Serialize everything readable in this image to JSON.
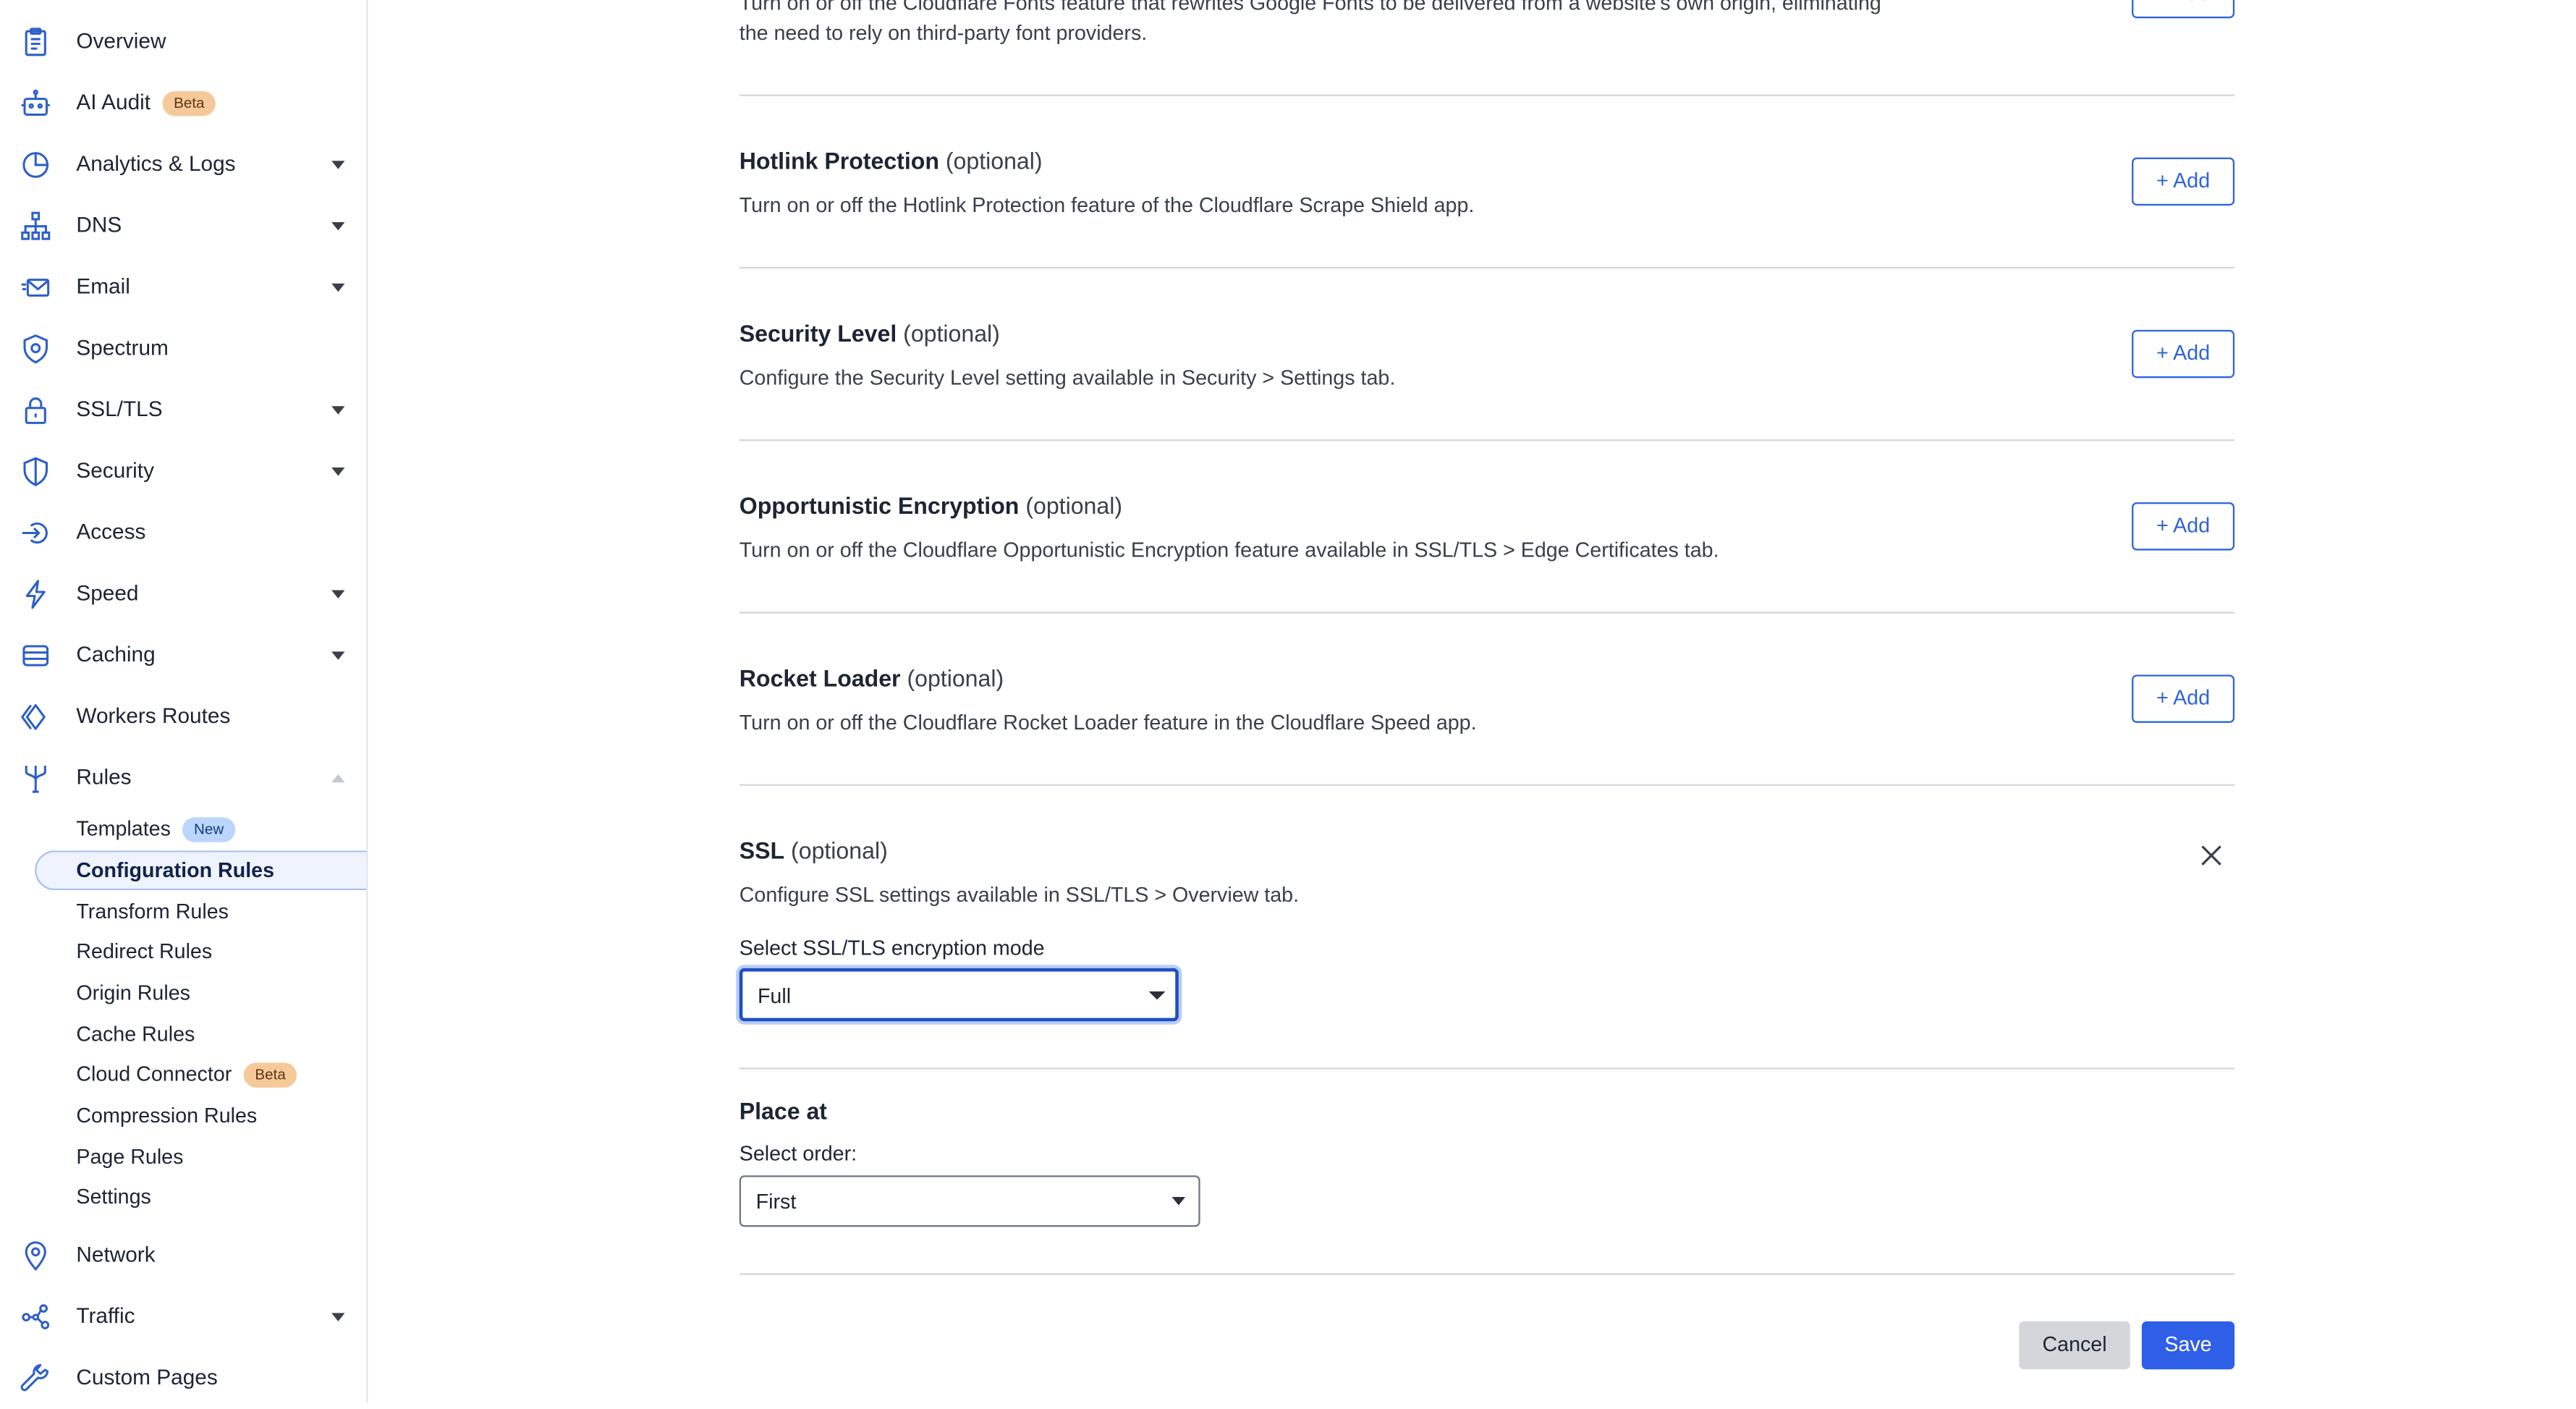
{
  "sidebar": {
    "items": [
      {
        "label": "Overview",
        "icon": "clipboard-icon"
      },
      {
        "label": "AI Audit",
        "icon": "robot-icon",
        "badge": "Beta"
      },
      {
        "label": "Analytics & Logs",
        "icon": "pie-chart-icon"
      },
      {
        "label": "DNS",
        "icon": "network-tree-icon"
      },
      {
        "label": "Email",
        "icon": "email-icon"
      },
      {
        "label": "Spectrum",
        "icon": "shield-gear-icon"
      },
      {
        "label": "SSL/TLS",
        "icon": "lock-icon"
      },
      {
        "label": "Security",
        "icon": "shield-icon"
      },
      {
        "label": "Access",
        "icon": "access-icon"
      },
      {
        "label": "Speed",
        "icon": "lightning-icon"
      },
      {
        "label": "Caching",
        "icon": "storage-icon"
      },
      {
        "label": "Workers Routes",
        "icon": "workers-icon"
      },
      {
        "label": "Rules",
        "icon": "rules-fork-icon"
      },
      {
        "label": "Network",
        "icon": "location-pin-icon"
      },
      {
        "label": "Traffic",
        "icon": "traffic-nodes-icon"
      },
      {
        "label": "Custom Pages",
        "icon": "wrench-icon"
      }
    ],
    "rules_sub": [
      {
        "label": "Templates",
        "badge": "New"
      },
      {
        "label": "Configuration Rules"
      },
      {
        "label": "Transform Rules"
      },
      {
        "label": "Redirect Rules"
      },
      {
        "label": "Origin Rules"
      },
      {
        "label": "Cache Rules"
      },
      {
        "label": "Cloud Connector",
        "badge": "Beta"
      },
      {
        "label": "Compression Rules"
      },
      {
        "label": "Page Rules"
      },
      {
        "label": "Settings"
      }
    ]
  },
  "main": {
    "fonts_desc_line1": "Turn on or off the Cloudflare Fonts feature that rewrites Google Fonts to be delivered from a website's own origin, eliminating",
    "fonts_desc_line2": "the need to rely on third-party font providers.",
    "add_label": "+ Add",
    "optional_label": "(optional)",
    "sections": [
      {
        "title": "Hotlink Protection",
        "desc": "Turn on or off the Hotlink Protection feature of the Cloudflare Scrape Shield app."
      },
      {
        "title": "Security Level",
        "desc": "Configure the Security Level setting available in Security > Settings tab."
      },
      {
        "title": "Opportunistic Encryption",
        "desc": "Turn on or off the Cloudflare Opportunistic Encryption feature available in SSL/TLS > Edge Certificates tab."
      },
      {
        "title": "Rocket Loader",
        "desc": "Turn on or off the Cloudflare Rocket Loader feature in the Cloudflare Speed app."
      }
    ],
    "ssl": {
      "title": "SSL",
      "desc": "Configure SSL settings available in SSL/TLS > Overview tab.",
      "field_label": "Select SSL/TLS encryption mode",
      "value": "Full"
    },
    "place_at": {
      "title": "Place at",
      "field_label": "Select order:",
      "value": "First"
    },
    "cancel_label": "Cancel",
    "save_label": "Save"
  },
  "colors": {
    "accent": "#2f63d8",
    "save_bg": "#2f5fe6",
    "beta_badge": "#f6c999",
    "new_badge": "#bcd5fb",
    "active_item_bg": "#eef3fd"
  }
}
